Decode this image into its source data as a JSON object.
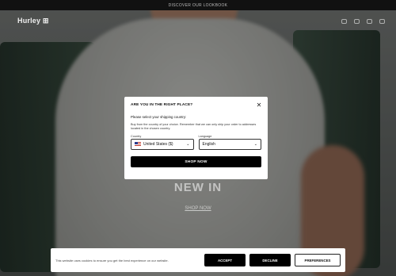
{
  "announcement": "DISCOVER OUR LOOKBOOK",
  "header": {
    "logo": "Hurley ⊞"
  },
  "hero": {
    "title": "NEW IN",
    "link": "SHOP NOW"
  },
  "modal": {
    "title": "ARE YOU IN THE RIGHT PLACE?",
    "subtitle": "Please select your shipping country:",
    "body": "Buy from the country of your choice. Remember that we can only ship your order to addresses located in the chosen country.",
    "country_label": "Country",
    "country_value": "United States ($)",
    "language_label": "Language",
    "language_value": "English",
    "button": "SHOP NOW",
    "close_glyph": "✕",
    "chevron_glyph": "⌄"
  },
  "cookie": {
    "text": "This website uses cookies to ensure you get the best experience on our website.",
    "accept": "ACCEPT",
    "decline": "DECLINE",
    "preferences": "PREFERENCES"
  }
}
